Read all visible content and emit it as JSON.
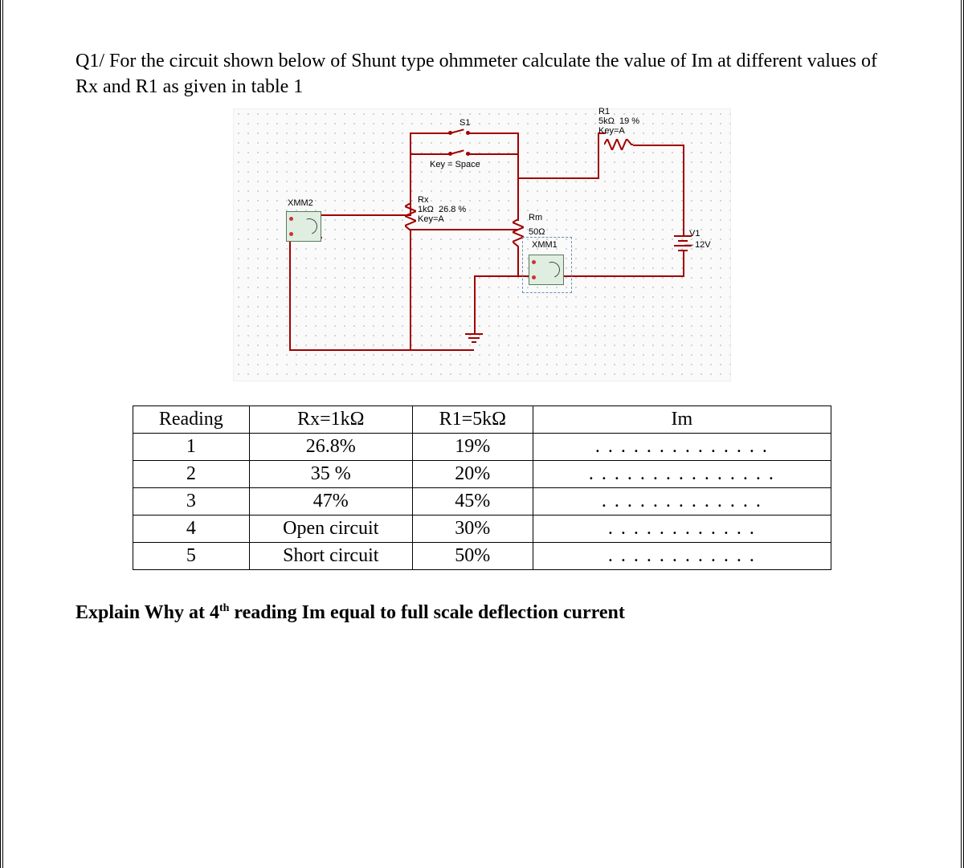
{
  "question": {
    "prefix": "Q1/ ",
    "text": "For the circuit shown below of Shunt type ohmmeter calculate the value of Im  at different values of Rx and R1 as given in table 1"
  },
  "circuit": {
    "s1_label": "S1",
    "s1_key": "Key = Space",
    "r1_label": "R1",
    "r1_value": "5kΩ",
    "r1_pct": "19 %",
    "r1_key": "Key=A",
    "rx_label": "Rx",
    "rx_value": "1kΩ",
    "rx_pct": "26.8 %",
    "rx_key": "Key=A",
    "rm_label": "Rm",
    "rm_value": "50Ω",
    "xmm1": "XMM1",
    "xmm2": "XMM2",
    "v1_label": "V1",
    "v1_value": "12V"
  },
  "table": {
    "headers": [
      "Reading",
      "Rx=1kΩ",
      "R1=5kΩ",
      "Im"
    ],
    "rows": [
      {
        "reading": "1",
        "rx": "26.8%",
        "r1": "19%",
        "im": ". . . . . . . . . . . . . ."
      },
      {
        "reading": "2",
        "rx": "35 %",
        "r1": "20%",
        "im": ". . . . . . . . . . . . . . ."
      },
      {
        "reading": "3",
        "rx": "47%",
        "r1": "45%",
        "im": ". . . . . . . . . . . . ."
      },
      {
        "reading": "4",
        "rx": "Open circuit",
        "r1": "30%",
        "im": ". . . . . . . . . . . ."
      },
      {
        "reading": "5",
        "rx": "Short circuit",
        "r1": "50%",
        "im": ". . . . . . . . . . . ."
      }
    ]
  },
  "explain": {
    "pre": "Explain Why at 4",
    "sup": "th",
    "post": " reading Im equal to full scale deflection current"
  }
}
